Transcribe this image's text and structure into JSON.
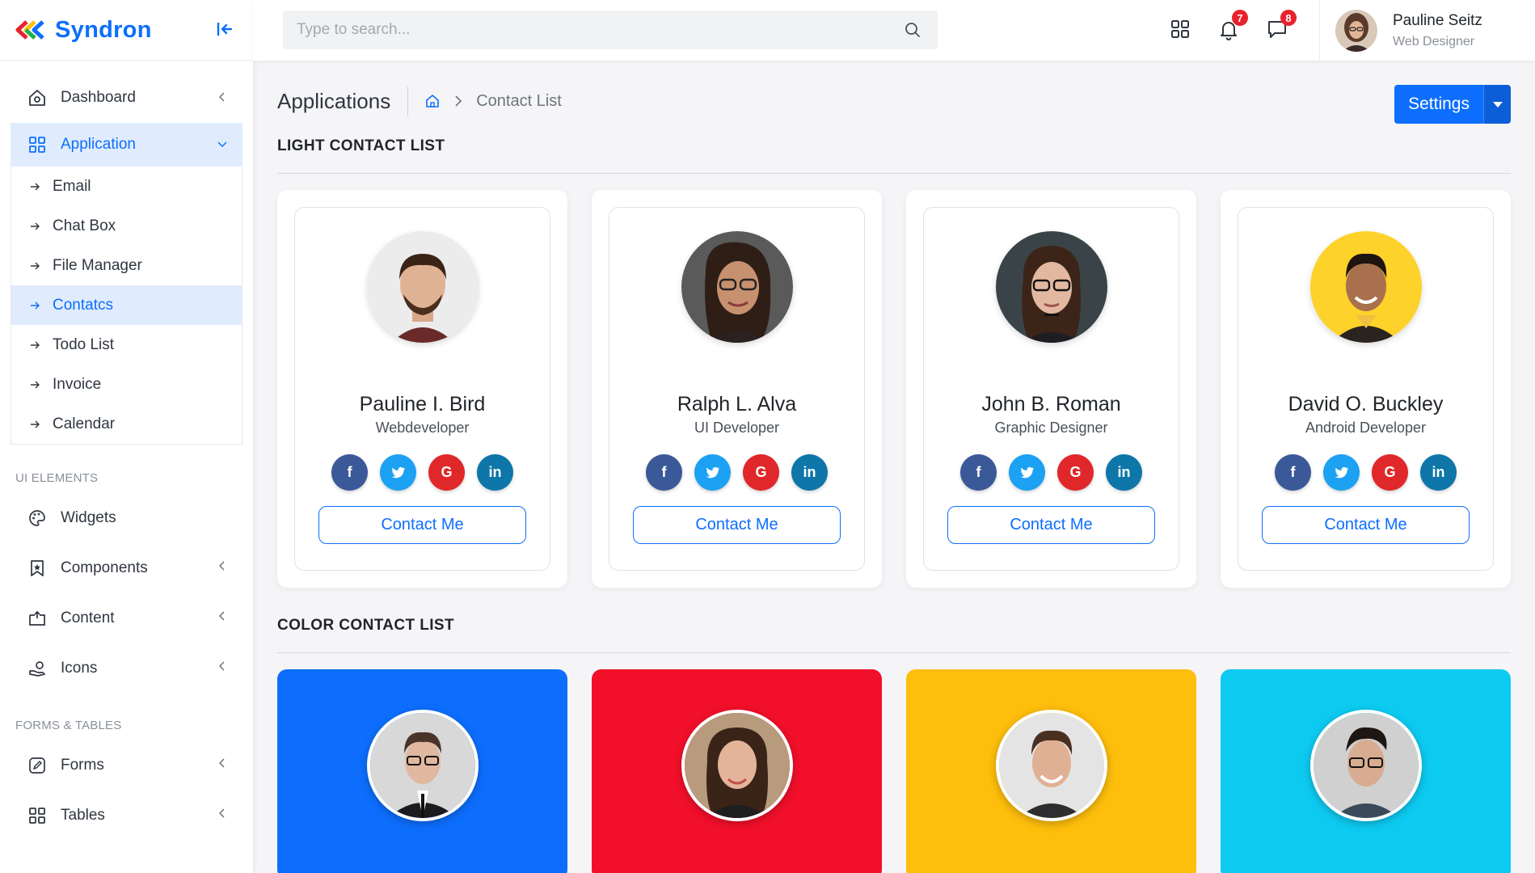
{
  "app": {
    "brand": "Syndron"
  },
  "sidebar": {
    "items": [
      {
        "label": "Dashboard",
        "icon": "home-icon"
      },
      {
        "label": "Application",
        "icon": "grid-icon",
        "active": true
      }
    ],
    "submenu": [
      "Email",
      "Chat Box",
      "File Manager",
      "Contatcs",
      "Todo List",
      "Invoice",
      "Calendar"
    ],
    "active_sub": "Contatcs",
    "sections": [
      {
        "label": "UI ELEMENTS",
        "items": [
          {
            "label": "Widgets",
            "icon": "palette-icon"
          },
          {
            "label": "Components",
            "icon": "bookmark-icon"
          },
          {
            "label": "Content",
            "icon": "repeat-icon"
          },
          {
            "label": "Icons",
            "icon": "donate-icon"
          }
        ]
      },
      {
        "label": "FORMS & TABLES",
        "items": [
          {
            "label": "Forms",
            "icon": "edit-icon"
          },
          {
            "label": "Tables",
            "icon": "table-icon"
          }
        ]
      }
    ]
  },
  "topbar": {
    "search_placeholder": "Type to search...",
    "notifications_count": "7",
    "messages_count": "8",
    "user_name": "Pauline Seitz",
    "user_role": "Web Designer"
  },
  "page": {
    "title": "Applications",
    "breadcrumb_current": "Contact List",
    "settings_label": "Settings",
    "light_section": "LIGHT CONTACT LIST",
    "color_section": "COLOR CONTACT LIST",
    "contact_label": "Contact Me"
  },
  "contacts": [
    {
      "name": "Pauline I. Bird",
      "role": "Webdeveloper"
    },
    {
      "name": "Ralph L. Alva",
      "role": "UI Developer"
    },
    {
      "name": "John B. Roman",
      "role": "Graphic Designer"
    },
    {
      "name": "David O. Buckley",
      "role": "Android Developer"
    }
  ],
  "color_cards": [
    {
      "color": "#0d6efd"
    },
    {
      "color": "#f20f2a"
    },
    {
      "color": "#fdbe0c"
    },
    {
      "color": "#0dcaf0"
    }
  ],
  "colors": {
    "primary": "#0d6efd",
    "facebook": "#3b5998",
    "twitter": "#1da1f2",
    "google": "#e0282a",
    "linkedin": "#0e76a8"
  }
}
